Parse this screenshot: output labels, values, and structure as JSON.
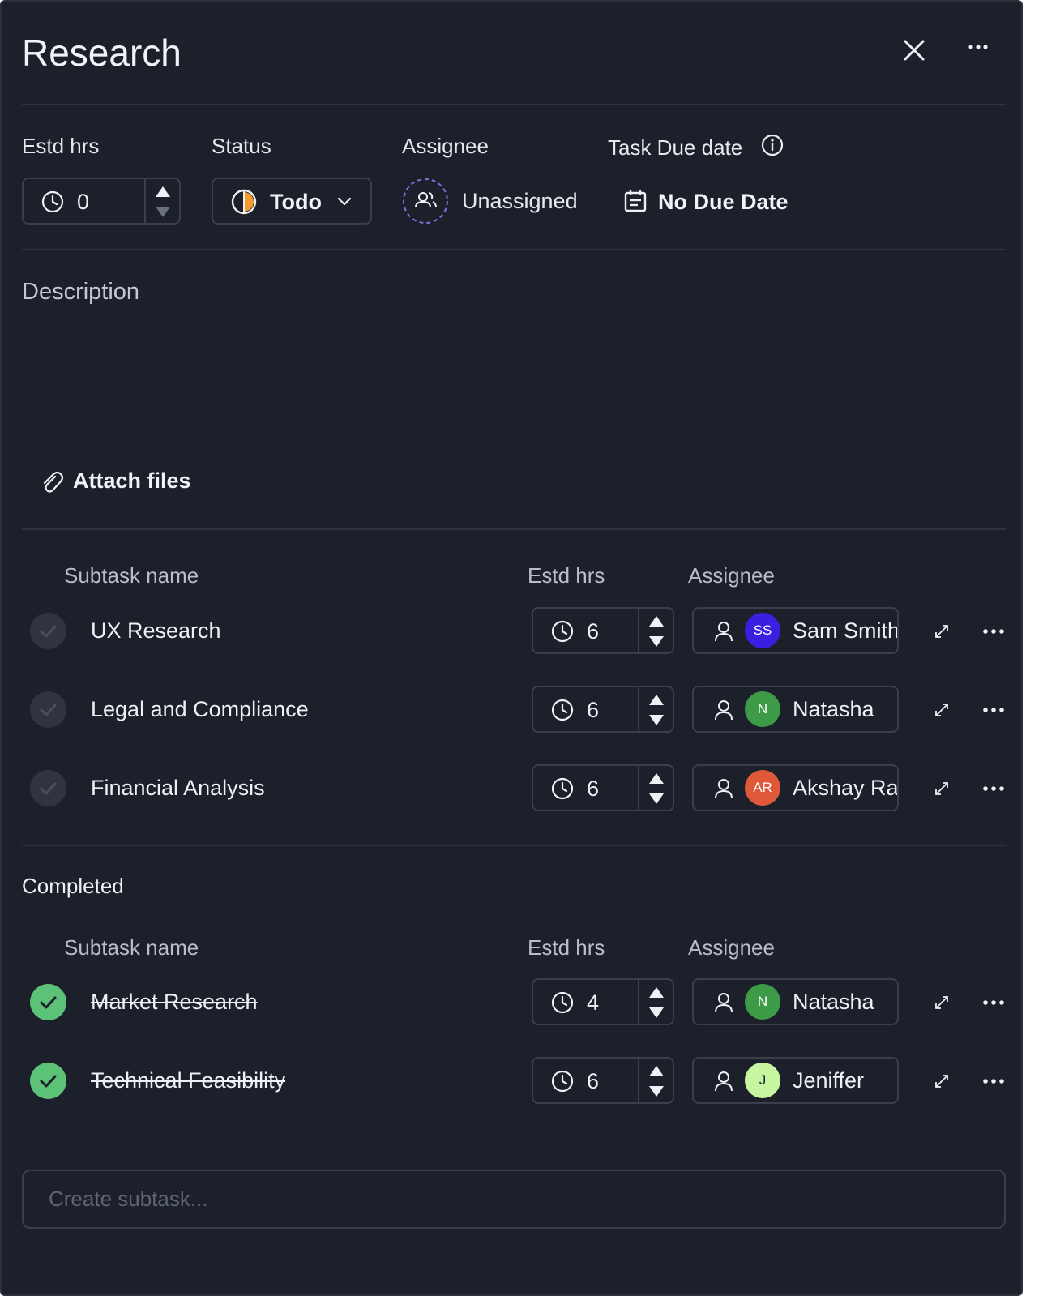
{
  "header": {
    "title": "Research"
  },
  "fields": {
    "estd_hrs_label": "Estd hrs",
    "estd_hrs_value": "0",
    "status_label": "Status",
    "status_value": "Todo",
    "assignee_label": "Assignee",
    "assignee_value": "Unassigned",
    "due_label": "Task Due date",
    "due_value": "No Due Date"
  },
  "description": {
    "label": "Description"
  },
  "attach": {
    "label": "Attach files"
  },
  "subtasks": {
    "col_name": "Subtask name",
    "col_hrs": "Estd hrs",
    "col_assignee": "Assignee",
    "open": [
      {
        "name": "UX Research",
        "hrs": "6",
        "initials": "SS",
        "assignee": "Sam Smith",
        "avatar_color": "#3b1fe0"
      },
      {
        "name": "Legal and Compliance",
        "hrs": "6",
        "initials": "N",
        "assignee": "Natasha",
        "avatar_color": "#3d9a47"
      },
      {
        "name": "Financial Analysis",
        "hrs": "6",
        "initials": "AR",
        "assignee": "Akshay Rao",
        "avatar_color": "#e0583a"
      }
    ],
    "completed_label": "Completed",
    "completed": [
      {
        "name": "Market Research",
        "hrs": "4",
        "initials": "N",
        "assignee": "Natasha",
        "avatar_color": "#3d9a47"
      },
      {
        "name": "Technical Feasibility",
        "hrs": "6",
        "initials": "J",
        "assignee": "Jeniffer",
        "avatar_color": "#c8f5a0"
      }
    ]
  },
  "create": {
    "placeholder": "Create subtask..."
  }
}
